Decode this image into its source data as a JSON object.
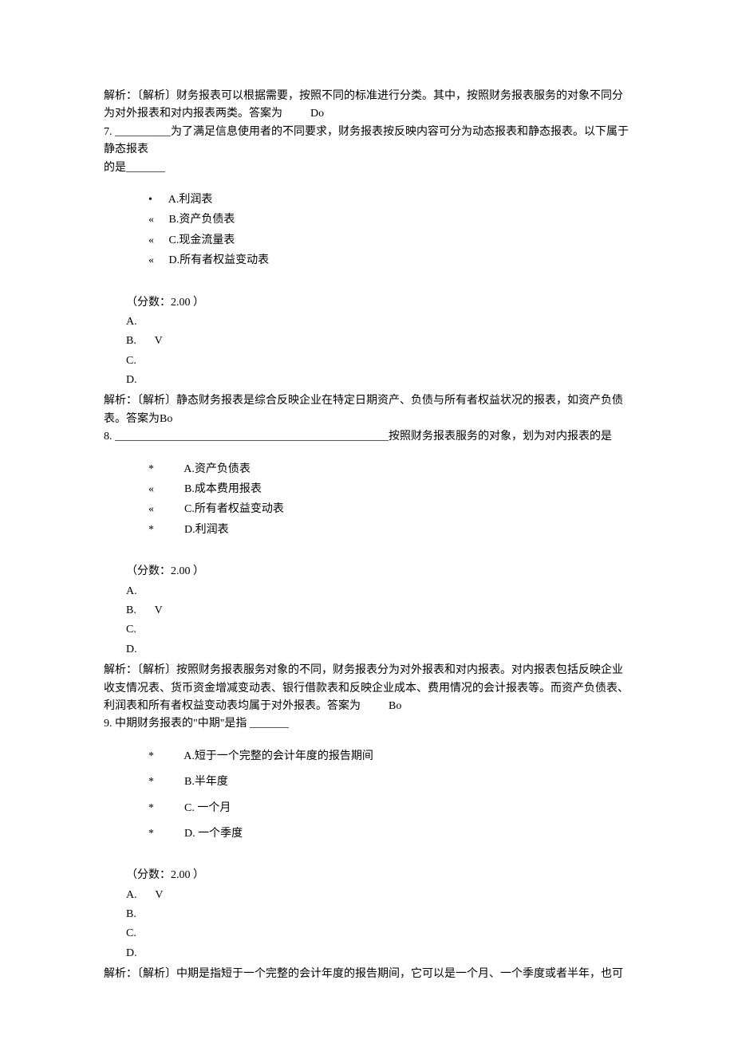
{
  "q6_analysis": "解析：〔解析〕财务报表可以根据需要，按照不同的标准进行分类。其中，按照财务报表服务的对象不同分为对外报表和对内报表两类。答案为",
  "q6_answer_tag": "Do",
  "q7": {
    "stem_a": "7. __________为了满足信息使用者的不同要求，财务报表按反映内容可分为动态报表和静态报表。以下属于静态报表",
    "stem_b": "的是_______",
    "opts": [
      "A.利润表",
      "B.资产负债表",
      "C.现金流量表",
      "D.所有者权益变动表"
    ],
    "opt_bullets": [
      "•",
      "«",
      "«",
      "«"
    ],
    "score_label": "（分数：2.00 ）",
    "answers": [
      "A.",
      "B.",
      "C.",
      "D."
    ],
    "correct_mark": "V",
    "correct_index": 1,
    "analysis": "解析：〔解析〕静态财务报表是综合反映企业在特定日期资产、负债与所有者权益状况的报表，如资产负债表。答案为Bo"
  },
  "q8": {
    "stem_a": "8. _________________________________________________按照财务报表服务的对象，划为对内报表的是",
    "opts": [
      "A.资产负债表",
      "B.成本费用报表",
      "C.所有者权益变动表",
      "D.利润表"
    ],
    "opt_bullets": [
      "*",
      "«",
      "«",
      "*"
    ],
    "score_label": "（分数：2.00 ）",
    "answers": [
      "A.",
      "B.",
      "C.",
      "D."
    ],
    "correct_mark": "V",
    "correct_index": 1,
    "analysis": "解析：〔解析〕按照财务报表服务对象的不同，财务报表分为对外报表和对内报表。对内报表包括反映企业收支情况表、货币资金增减变动表、银行借款表和反映企业成本、费用情况的会计报表等。而资产负债表、利润表和所有者权益变动表均属于对外报表。答案为",
    "answer_tag": "Bo"
  },
  "q9": {
    "stem_a": "9. 中期财务报表的\"中期\"是指   _______",
    "opts": [
      "A.短于一个完整的会计年度的报告期间",
      "B.半年度",
      "C. 一个月",
      "D. 一个季度"
    ],
    "opt_bullets": [
      "*",
      "*",
      "*",
      "*"
    ],
    "score_label": "（分数：2.00 ）",
    "answers": [
      "A.",
      "B.",
      "C.",
      "D."
    ],
    "correct_mark": "V",
    "correct_index": 0,
    "analysis": "解析：〔解析〕中期是指短于一个完整的会计年度的报告期间，它可以是一个月、一个季度或者半年，也可"
  }
}
